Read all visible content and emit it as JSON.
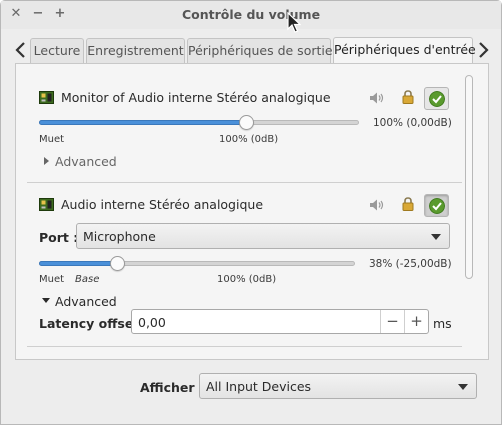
{
  "window": {
    "title": "Contrôle du volume"
  },
  "titlebar": {
    "close_glyph": "✕",
    "minimize_glyph": "−",
    "maximize_glyph": "+"
  },
  "tabs": [
    {
      "label": "Lecture",
      "active": false
    },
    {
      "label": "Enregistrement",
      "active": false
    },
    {
      "label": "Périphériques de sortie",
      "active": false
    },
    {
      "label": "Périphériques d'entrée",
      "active": true
    }
  ],
  "devices": [
    {
      "name": "Monitor of Audio interne Stéréo analogique",
      "volume_fraction": 1.0,
      "volume_text": "100% (0,00dB)",
      "mute_label": "Muet",
      "mark_100": "100% (0dB)",
      "advanced_label": "Advanced",
      "advanced_open": false
    },
    {
      "name": "Audio interne Stéréo analogique",
      "port_label": "Port :",
      "port_value": "Microphone",
      "volume_fraction": 0.38,
      "volume_text": "38% (-25,00dB)",
      "mute_label": "Muet",
      "base_label": "Base",
      "mark_100": "100% (0dB)",
      "advanced_label": "Advanced",
      "advanced_open": true,
      "latency_label": "Latency offset:",
      "latency_value": "0,00",
      "latency_unit": "ms",
      "minus_glyph": "−",
      "plus_glyph": "+"
    }
  ],
  "footer": {
    "show_label": "Afficher :",
    "show_value": "All Input Devices"
  },
  "colors": {
    "accent": "#4a90d9",
    "default_check": "#5a9a2e"
  }
}
